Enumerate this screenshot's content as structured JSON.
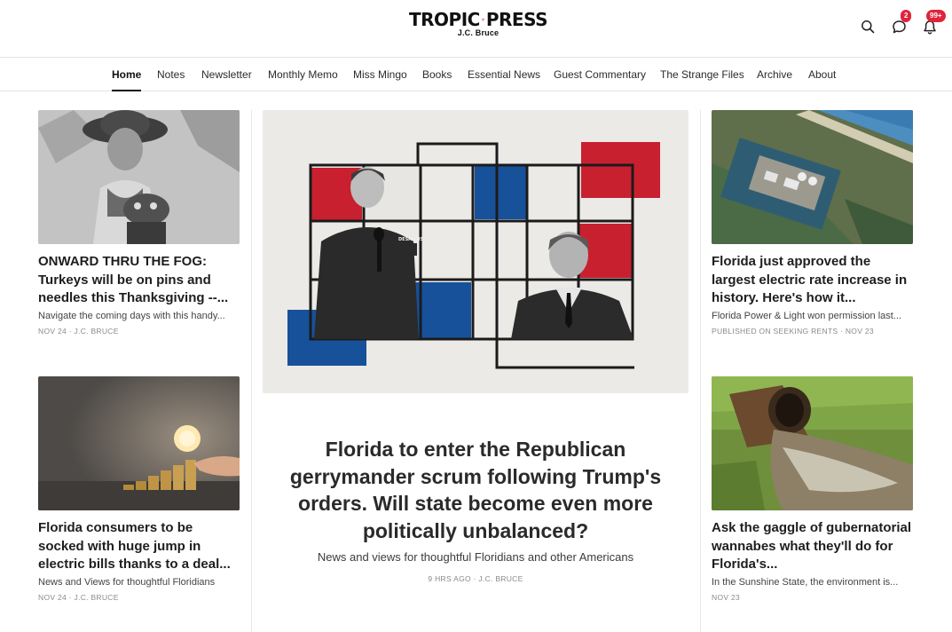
{
  "header": {
    "logo_left": "TROPIC",
    "logo_right": "PRESS",
    "logo_byline": "J.C. Bruce",
    "search_icon": "search-icon",
    "chat_icon": "chat-bubble-icon",
    "chat_badge": "2",
    "bell_icon": "bell-icon",
    "bell_badge": "99+",
    "accent": "#e0243b"
  },
  "nav": {
    "items": [
      {
        "label": "Home",
        "active": true
      },
      {
        "label": "Notes"
      },
      {
        "label": "Newsletter"
      },
      {
        "label": "Monthly Memo"
      },
      {
        "label": "Miss Mingo"
      },
      {
        "label": "Books"
      },
      {
        "label": "Essential News"
      },
      {
        "label": "Guest Commentary"
      },
      {
        "label": "The Strange Files"
      },
      {
        "label": "Archive"
      },
      {
        "label": "About"
      }
    ]
  },
  "left_posts": [
    {
      "title": "ONWARD THRU THE FOG: Turkeys will be on pins and needles this Thanksgiving --...",
      "subtitle": "Navigate the coming days with this handy...",
      "meta": "NOV 24 · J.C. BRUCE"
    },
    {
      "title": "Florida consumers to be socked with huge jump in electric bills thanks to a deal...",
      "subtitle": "News and Views for thoughtful Floridians",
      "meta": "NOV 24 · J.C. BRUCE"
    }
  ],
  "feature": {
    "title": "Florida to enter the Republican gerrymander scrum following Trump's orders. Will state become even more politically unbalanced?",
    "subtitle": "News and views for thoughtful Floridians and other Americans",
    "meta": "9 HRS AGO · J.C. BRUCE",
    "badge_text": "DESANTIS"
  },
  "right_posts": [
    {
      "title": "Florida just approved the largest electric rate increase in history. Here's how it...",
      "subtitle": "Florida Power & Light won permission last...",
      "meta": "PUBLISHED ON SEEKING RENTS · NOV 23"
    },
    {
      "title": "Ask the gaggle of gubernatorial wannabes what they'll do for Florida's...",
      "subtitle": "In the Sunshine State, the environment is...",
      "meta": "NOV 23"
    }
  ]
}
